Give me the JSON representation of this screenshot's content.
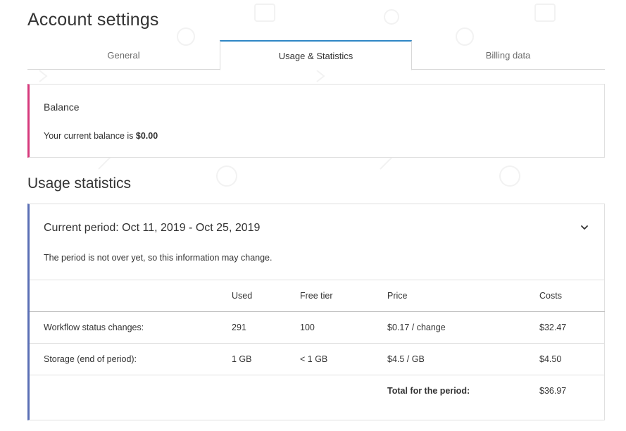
{
  "page": {
    "title": "Account settings"
  },
  "tabs": [
    {
      "label": "General",
      "active": false
    },
    {
      "label": "Usage & Statistics",
      "active": true
    },
    {
      "label": "Billing data",
      "active": false
    }
  ],
  "balance": {
    "title": "Balance",
    "text_prefix": "Your current balance is ",
    "amount": "$0.00"
  },
  "usage": {
    "section_title": "Usage statistics",
    "period_title": "Current period: Oct 11, 2019 - Oct 25, 2019",
    "period_note": "The period is not over yet, so this information may change.",
    "columns": [
      "",
      "Used",
      "Free tier",
      "Price",
      "Costs"
    ],
    "rows": [
      {
        "label": "Workflow status changes:",
        "used": "291",
        "free_tier": "100",
        "price": "$0.17 / change",
        "costs": "$32.47"
      },
      {
        "label": "Storage (end of period):",
        "used": "1 GB",
        "free_tier": "< 1 GB",
        "price": "$4.5 / GB",
        "costs": "$4.50"
      }
    ],
    "total_label": "Total for the period:",
    "total_value": "$36.97"
  },
  "colors": {
    "tab_active_accent": "#2f86c5",
    "balance_accent": "#d6397c",
    "usage_accent": "#5a6fb5"
  },
  "icons": {
    "expand": "chevron-down-icon"
  }
}
